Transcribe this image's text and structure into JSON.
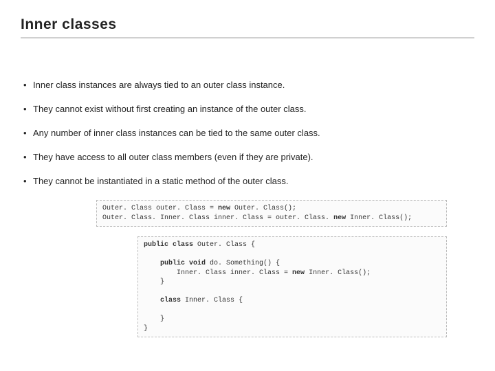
{
  "title": "Inner classes",
  "bullets": [
    "Inner class instances are always tied to an outer class instance.",
    "They cannot exist without first creating an instance of the outer class.",
    "Any number of inner class instances can be tied to the same outer class.",
    "They have access to all outer class members (even if they are private).",
    "They cannot be instantiated in a static method of the outer class."
  ],
  "code1": {
    "l1a": "Outer. Class outer. Class = ",
    "l1b": "new",
    "l1c": " Outer. Class();",
    "l2a": "Outer. Class. Inner. Class inner. Class = outer. Class. ",
    "l2b": "new",
    "l2c": " Inner. Class();"
  },
  "code2": {
    "l1a": "public class",
    "l1b": " Outer. Class {",
    "l2a": "    public void",
    "l2b": " do. Something() {",
    "l3a": "        Inner. Class inner. Class = ",
    "l3b": "new",
    "l3c": " Inner. Class();",
    "l4": "    }",
    "l5a": "    class",
    "l5b": " Inner. Class {",
    "l6": "    }",
    "l7": "}"
  }
}
